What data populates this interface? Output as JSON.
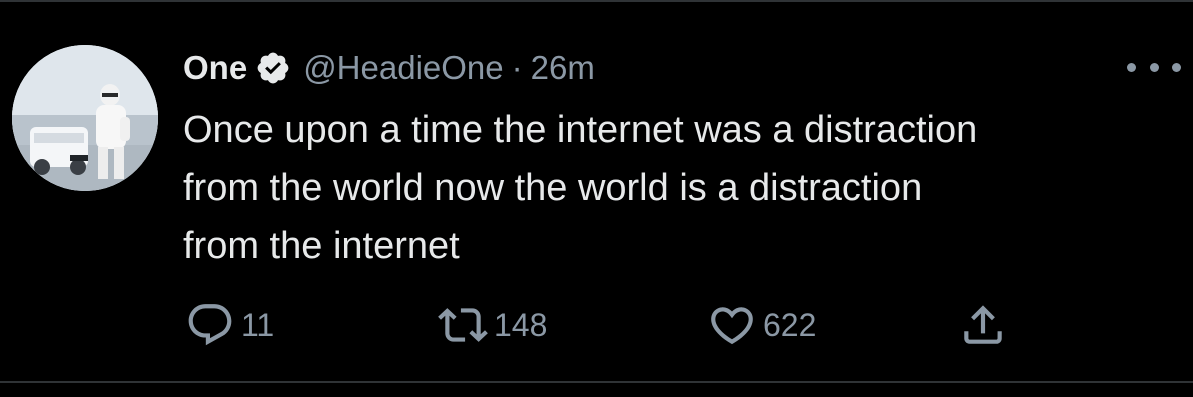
{
  "tweet": {
    "display_name": "One",
    "handle": "@HeadieOne",
    "separator": "·",
    "timestamp": "26m",
    "text": "Once upon a time the internet was a distraction\nfrom the world now the world is a distraction\nfrom the internet"
  },
  "actions": {
    "replies": "11",
    "retweets": "148",
    "likes": "622"
  },
  "icons": {
    "verified": "verified-badge-icon",
    "more": "more-icon",
    "reply": "reply-icon",
    "retweet": "retweet-icon",
    "like": "heart-icon",
    "share": "share-icon"
  },
  "colors": {
    "background": "#000000",
    "text": "#e7e9ea",
    "secondary": "#8b98a5",
    "divider": "#2f3336"
  }
}
